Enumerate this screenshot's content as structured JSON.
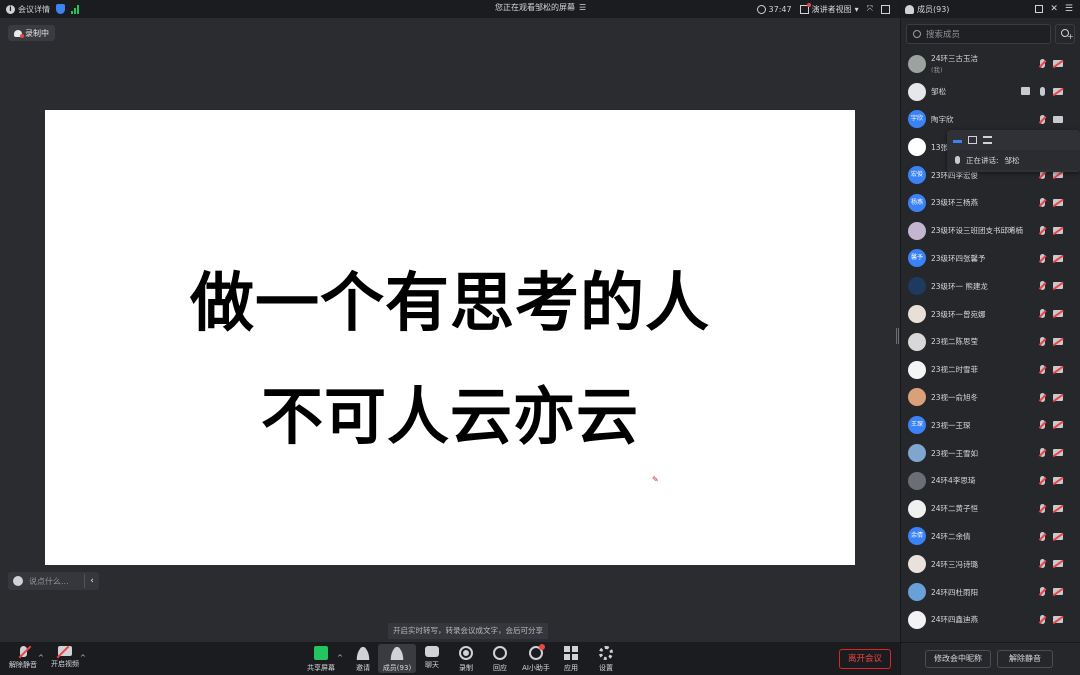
{
  "topbar": {
    "meeting_details": "会议详情",
    "center_text": "您正在观看邹松的屏幕",
    "center_icon": "menu-icon",
    "timer": "37:47",
    "view_label": "演讲者视图",
    "view_caret": "▾"
  },
  "stage": {
    "recording_label": "录制中",
    "slide_line1": "做一个有思考的人",
    "slide_line2": "不可人云亦云",
    "chat_placeholder": "说点什么...",
    "chat_collapse": "‹",
    "hint": "开启实时转写，转录会议成文字，会后可分享"
  },
  "toolbar": {
    "buttons": [
      {
        "label": "解除静音"
      },
      {
        "label": "开启视频"
      },
      {
        "label": "共享屏幕"
      },
      {
        "label": "邀请"
      },
      {
        "label": "成员(93)"
      },
      {
        "label": "聊天"
      },
      {
        "label": "录制"
      },
      {
        "label": "回应"
      },
      {
        "label": "AI小助手"
      },
      {
        "label": "应用"
      },
      {
        "label": "设置"
      }
    ],
    "leave_label": "离开会议",
    "caret": "^"
  },
  "panel": {
    "title": "成员(93)",
    "search_placeholder": "搜索成员",
    "members": [
      {
        "name": "24环三古玉洁",
        "sub": "(我)",
        "avatar_text": "",
        "avatar_color": "#9aa3a0",
        "mic_off": true,
        "cam_off": true
      },
      {
        "name": "邹松",
        "sub": "",
        "avatar_text": "",
        "avatar_color": "#e5e7eb",
        "mic_off": false,
        "cam_off": true,
        "sharing": true
      },
      {
        "name": "陶宇欣",
        "sub": "",
        "avatar_text": "宇欣",
        "avatar_color": "#3b82f6",
        "mic_off": true,
        "cam_off": false
      },
      {
        "name": "13张",
        "sub": "",
        "avatar_text": "",
        "avatar_color": "#ffffff",
        "mic_off": true,
        "cam_off": true
      },
      {
        "name": "23环四李宏俊",
        "sub": "",
        "avatar_text": "宏俊",
        "avatar_color": "#3b82f6",
        "mic_off": true,
        "cam_off": true
      },
      {
        "name": "23级环三杨燕",
        "sub": "",
        "avatar_text": "杨燕",
        "avatar_color": "#3b82f6",
        "mic_off": true,
        "cam_off": true
      },
      {
        "name": "23级环设三班团支书邱晞楠",
        "sub": "",
        "avatar_text": "",
        "avatar_color": "#c4b5d0",
        "mic_off": true,
        "cam_off": true
      },
      {
        "name": "23级环四张馨予",
        "sub": "",
        "avatar_text": "馨予",
        "avatar_color": "#3b82f6",
        "mic_off": true,
        "cam_off": true
      },
      {
        "name": "23级环一 熊建龙",
        "sub": "",
        "avatar_text": "",
        "avatar_color": "#1e3a5f",
        "mic_off": true,
        "cam_off": true
      },
      {
        "name": "23级环一曾宛娜",
        "sub": "",
        "avatar_text": "",
        "avatar_color": "#e8e0d8",
        "mic_off": true,
        "cam_off": true
      },
      {
        "name": "23视二陈思莹",
        "sub": "",
        "avatar_text": "",
        "avatar_color": "#d8d8d8",
        "mic_off": true,
        "cam_off": true
      },
      {
        "name": "23视二时雪菲",
        "sub": "",
        "avatar_text": "",
        "avatar_color": "#f5f5f5",
        "mic_off": true,
        "cam_off": true
      },
      {
        "name": "23视一俞旭冬",
        "sub": "",
        "avatar_text": "",
        "avatar_color": "#d9a07a",
        "mic_off": true,
        "cam_off": true
      },
      {
        "name": "23视一王琛",
        "sub": "",
        "avatar_text": "王琛",
        "avatar_color": "#3b82f6",
        "mic_off": true,
        "cam_off": true
      },
      {
        "name": "23视一王雪如",
        "sub": "",
        "avatar_text": "",
        "avatar_color": "#7ea6cf",
        "mic_off": true,
        "cam_off": true
      },
      {
        "name": "24环4李思琦",
        "sub": "",
        "avatar_text": "",
        "avatar_color": "#6b6e75",
        "mic_off": true,
        "cam_off": true
      },
      {
        "name": "24环二黄子恒",
        "sub": "",
        "avatar_text": "",
        "avatar_color": "#f0f0f0",
        "mic_off": true,
        "cam_off": true
      },
      {
        "name": "24环二余倩",
        "sub": "",
        "avatar_text": "余倩",
        "avatar_color": "#3b82f6",
        "mic_off": true,
        "cam_off": true
      },
      {
        "name": "24环三冯诗璐",
        "sub": "",
        "avatar_text": "",
        "avatar_color": "#e9e1dc",
        "mic_off": true,
        "cam_off": true
      },
      {
        "name": "24环四杜雨阳",
        "sub": "",
        "avatar_text": "",
        "avatar_color": "#6aa0d8",
        "mic_off": true,
        "cam_off": true
      },
      {
        "name": "24环四鑫迪燕",
        "sub": "",
        "avatar_text": "",
        "avatar_color": "#f2f2f2",
        "mic_off": true,
        "cam_off": true
      }
    ],
    "speaking_label": "正在讲话:",
    "speaking_name": "邹松",
    "footer_rename": "修改会中昵称",
    "footer_unmute": "解除静音"
  },
  "colors": {
    "accent": "#3b82f6",
    "danger": "#ef4444",
    "record_green": "#22c55e"
  }
}
